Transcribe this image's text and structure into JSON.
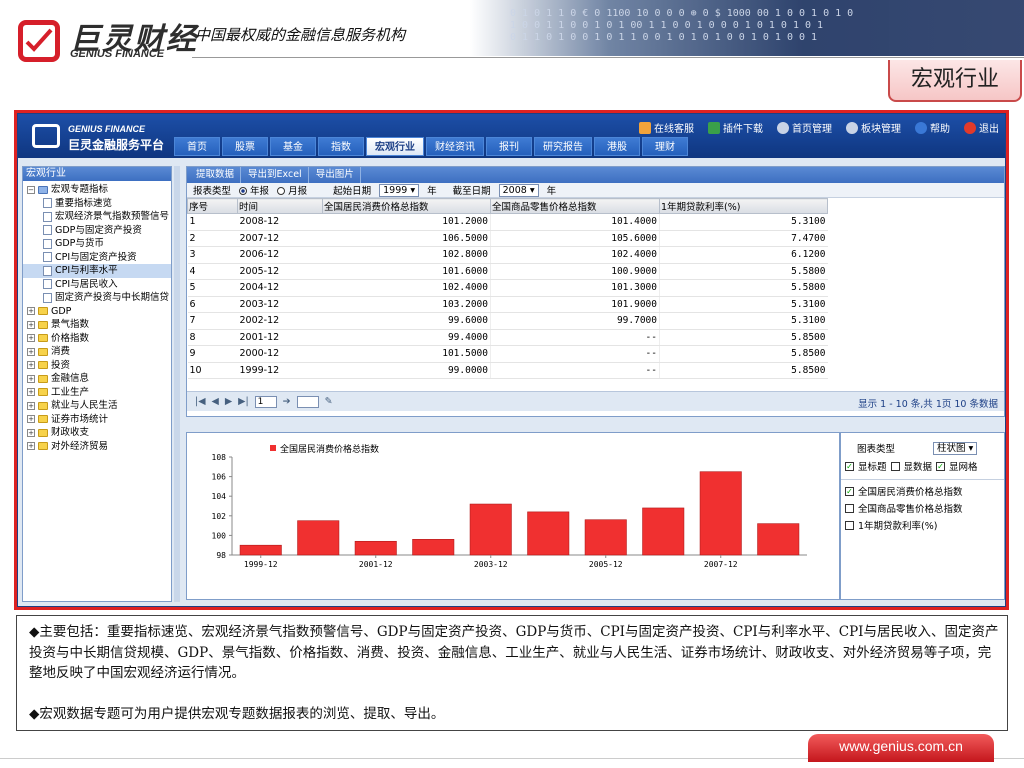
{
  "page": {
    "logo_cn": "巨灵财经",
    "logo_en": "GENIUS FINANCE",
    "slogan": "中国最权威的金融信息服务机构",
    "section": "宏观行业",
    "footer_url": "www.genius.com.cn"
  },
  "app": {
    "brand_en": "GENIUS FINANCE",
    "brand_cn": "巨灵金融服务平台",
    "top_links": [
      "在线客服",
      "插件下载",
      "首页管理",
      "板块管理",
      "帮助",
      "退出"
    ],
    "menu": [
      "首页",
      "股票",
      "基金",
      "指数",
      "宏观行业",
      "财经资讯",
      "报刊",
      "研究报告",
      "港股",
      "理财"
    ],
    "active_menu": "宏观行业"
  },
  "sidebar": {
    "title": "宏观行业",
    "root": "宏观专题指标",
    "items": [
      "重要指标速览",
      "宏观经济景气指数预警信号",
      "GDP与固定资产投资",
      "GDP与货币",
      "CPI与固定资产投资",
      "CPI与利率水平",
      "CPI与居民收入",
      "固定资产投资与中长期信贷"
    ],
    "selected": "CPI与利率水平",
    "folders": [
      "GDP",
      "景气指数",
      "价格指数",
      "消费",
      "投资",
      "金融信息",
      "工业生产",
      "就业与人民生活",
      "证券市场统计",
      "财政收支",
      "对外经济贸易"
    ]
  },
  "toolbar": {
    "buttons": [
      "提取数据",
      "导出到Excel",
      "导出图片"
    ]
  },
  "filters": {
    "type_label": "报表类型",
    "yearly": "年报",
    "monthly": "月报",
    "start_label": "起始日期",
    "start_value": "1999",
    "year_unit": "年",
    "end_label": "截至日期",
    "end_value": "2008"
  },
  "table": {
    "headers": [
      "序号",
      "时间",
      "全国居民消费价格总指数",
      "全国商品零售价格总指数",
      "1年期贷款利率(%)"
    ],
    "rows": [
      [
        "1",
        "2008-12",
        "101.2000",
        "101.4000",
        "5.3100"
      ],
      [
        "2",
        "2007-12",
        "106.5000",
        "105.6000",
        "7.4700"
      ],
      [
        "3",
        "2006-12",
        "102.8000",
        "102.4000",
        "6.1200"
      ],
      [
        "4",
        "2005-12",
        "101.6000",
        "100.9000",
        "5.5800"
      ],
      [
        "5",
        "2004-12",
        "102.4000",
        "101.3000",
        "5.5800"
      ],
      [
        "6",
        "2003-12",
        "103.2000",
        "101.9000",
        "5.3100"
      ],
      [
        "7",
        "2002-12",
        "99.6000",
        "99.7000",
        "5.3100"
      ],
      [
        "8",
        "2001-12",
        "99.4000",
        "--",
        "5.8500"
      ],
      [
        "9",
        "2000-12",
        "101.5000",
        "--",
        "5.8500"
      ],
      [
        "10",
        "1999-12",
        "99.0000",
        "--",
        "5.8500"
      ]
    ]
  },
  "pager": {
    "page": "1",
    "info": "显示 1 - 10 条,共 1页 10 条数据"
  },
  "options": {
    "chart_type_label": "图表类型",
    "chart_type_value": "柱状图",
    "show_title": "显标题",
    "show_data": "显数据",
    "show_grid": "显网格",
    "series": [
      "全国居民消费价格总指数",
      "全国商品零售价格总指数",
      "1年期贷款利率(%)"
    ]
  },
  "colors": {
    "bar": "#f03030",
    "accent": "#1d4fa8",
    "frame": "#d22222"
  },
  "bullets": [
    "主要包括：重要指标速览、宏观经济景气指数预警信号、GDP与固定资产投资、GDP与货币、CPI与固定资产投资、CPI与利率水平、CPI与居民收入、固定资产投资与中长期信贷规模、GDP、景气指数、价格指数、消费、投资、金融信息、工业生产、就业与人民生活、证券市场统计、财政收支、对外经济贸易等子项，完整地反映了中国宏观经济运行情况。",
    "宏观数据专题可为用户提供宏观专题数据报表的浏览、提取、导出。"
  ],
  "chart_data": {
    "type": "bar",
    "categories": [
      "1999-12",
      "2000-12",
      "2001-12",
      "2002-12",
      "2003-12",
      "2004-12",
      "2005-12",
      "2006-12",
      "2007-12",
      "2008-12"
    ],
    "series": [
      {
        "name": "全国居民消费价格总指数",
        "values": [
          99.0,
          101.5,
          99.4,
          99.6,
          103.2,
          102.4,
          101.6,
          102.8,
          106.5,
          101.2
        ]
      }
    ],
    "tick_labels": [
      "1999-12",
      "2001-12",
      "2003-12",
      "2005-12",
      "2007-12"
    ],
    "yticks": [
      "98",
      "100",
      "102",
      "104",
      "106",
      "108"
    ],
    "ylim": [
      98,
      108
    ],
    "legend": "top-left"
  }
}
